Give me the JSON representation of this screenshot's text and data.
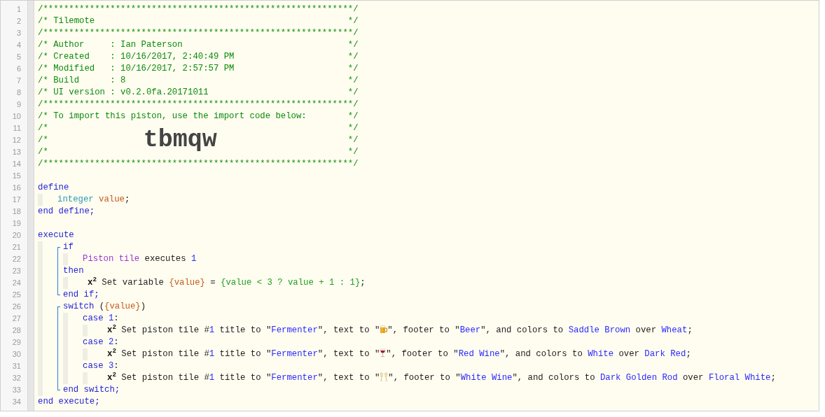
{
  "lines": [
    {
      "kind": "line",
      "n": "1",
      "tokens": [
        {
          "kind": "comment",
          "text": "/************************************************************/"
        }
      ]
    },
    {
      "kind": "line",
      "n": "2",
      "tokens": [
        {
          "kind": "comment",
          "text": "/* Tilemote                                                 */"
        }
      ]
    },
    {
      "kind": "line",
      "n": "3",
      "tokens": [
        {
          "kind": "comment",
          "text": "/************************************************************/"
        }
      ]
    },
    {
      "kind": "line",
      "n": "4",
      "tokens": [
        {
          "kind": "comment",
          "text": "/* Author     : Ian Paterson                                */"
        }
      ]
    },
    {
      "kind": "line",
      "n": "5",
      "tokens": [
        {
          "kind": "comment",
          "text": "/* Created    : 10/16/2017, 2:40:49 PM                      */"
        }
      ]
    },
    {
      "kind": "line",
      "n": "6",
      "tokens": [
        {
          "kind": "comment",
          "text": "/* Modified   : 10/16/2017, 2:57:57 PM                      */"
        }
      ]
    },
    {
      "kind": "line",
      "n": "7",
      "tokens": [
        {
          "kind": "comment",
          "text": "/* Build      : 8                                           */"
        }
      ]
    },
    {
      "kind": "line",
      "n": "8",
      "tokens": [
        {
          "kind": "comment",
          "text": "/* UI version : v0.2.0fa.20171011                           */"
        }
      ]
    },
    {
      "kind": "line",
      "n": "9",
      "tokens": [
        {
          "kind": "comment",
          "text": "/************************************************************/"
        }
      ]
    },
    {
      "kind": "line",
      "n": "10",
      "tokens": [
        {
          "kind": "comment",
          "text": "/* To import this piston, use the import code below:        */"
        }
      ]
    },
    {
      "kind": "line",
      "n": "11",
      "tokens": [
        {
          "kind": "comment",
          "text": "/*"
        },
        {
          "kind": "comment_end",
          "text": "*/"
        }
      ]
    },
    {
      "kind": "line",
      "n": "12",
      "tokens": [
        {
          "kind": "comment",
          "text": "/*"
        },
        {
          "kind": "import",
          "text": "tbmqw"
        },
        {
          "kind": "comment_end",
          "text": "*/"
        }
      ]
    },
    {
      "kind": "line",
      "n": "13",
      "tokens": [
        {
          "kind": "comment",
          "text": "/*"
        },
        {
          "kind": "comment_end",
          "text": "*/"
        }
      ]
    },
    {
      "kind": "line",
      "n": "14",
      "tokens": [
        {
          "kind": "comment",
          "text": "/************************************************************/"
        }
      ]
    },
    {
      "kind": "line",
      "n": "15"
    },
    {
      "kind": "line",
      "n": "16",
      "tokens": [
        {
          "kind": "keyword",
          "text": "define"
        }
      ],
      "children": [
        {
          "kind": "line",
          "n": "17",
          "tokens": [
            {
              "kind": "type",
              "text": "integer "
            },
            {
              "kind": "variable",
              "text": "value"
            },
            {
              "kind": "plain",
              "text": ";"
            }
          ]
        }
      ]
    },
    {
      "kind": "line",
      "n": "18",
      "tokens": [
        {
          "kind": "keyword",
          "text": "end define;"
        }
      ]
    },
    {
      "kind": "line",
      "n": "19"
    },
    {
      "kind": "line",
      "n": "20",
      "tokens": [
        {
          "kind": "keyword",
          "text": "execute"
        }
      ],
      "children": [
        {
          "kind": "block",
          "lines": [
            {
              "kind": "line",
              "n": "21",
              "tokens": [
                {
                  "kind": "keyword",
                  "text": "if"
                }
              ],
              "children": [
                {
                  "kind": "line",
                  "n": "22",
                  "tokens": [
                    {
                      "kind": "device",
                      "text": "Piston tile"
                    },
                    {
                      "kind": "plain",
                      "text": " executes "
                    },
                    {
                      "kind": "literal",
                      "text": "1"
                    }
                  ]
                }
              ]
            },
            {
              "kind": "line",
              "n": "23",
              "tokens": [
                {
                  "kind": "keyword",
                  "text": "then"
                }
              ],
              "children": [
                {
                  "kind": "line",
                  "n": "24",
                  "tokens": [
                    {
                      "kind": "task",
                      "text": "x$^{2}$"
                    },
                    {
                      "kind": "plain",
                      "text": " Set variable "
                    },
                    {
                      "kind": "variable",
                      "text": "{value}"
                    },
                    {
                      "kind": "plain",
                      "text": " = "
                    },
                    {
                      "kind": "expression",
                      "text": "{value < 3 ? value + 1 : 1}"
                    },
                    {
                      "kind": "plain",
                      "text": ";"
                    }
                  ]
                }
              ]
            },
            {
              "kind": "line",
              "n": "25",
              "tokens": [
                {
                  "kind": "keyword",
                  "text": "end if;"
                }
              ]
            }
          ]
        },
        {
          "kind": "block",
          "lines": [
            {
              "kind": "line",
              "n": "26",
              "tokens": [
                {
                  "kind": "keyword",
                  "text": "switch"
                },
                {
                  "kind": "plain",
                  "text": " ("
                },
                {
                  "kind": "variable",
                  "text": "{value}"
                },
                {
                  "kind": "plain",
                  "text": ")"
                }
              ],
              "children": [
                {
                  "kind": "line",
                  "n": "27",
                  "tokens": [
                    {
                      "kind": "keyword",
                      "text": "case "
                    },
                    {
                      "kind": "literal",
                      "text": "1"
                    },
                    {
                      "kind": "plain",
                      "text": ":"
                    }
                  ],
                  "children": [
                    {
                      "kind": "line",
                      "n": "28",
                      "tokens": [
                        {
                          "kind": "task",
                          "text": "x$^{2}$"
                        },
                        {
                          "kind": "plain",
                          "text": " Set piston tile #"
                        },
                        {
                          "kind": "literal",
                          "text": "1"
                        },
                        {
                          "kind": "plain",
                          "text": " title to \""
                        },
                        {
                          "kind": "literal",
                          "text": "Fermenter"
                        },
                        {
                          "kind": "plain",
                          "text": "\", text to \""
                        },
                        {
                          "kind": "icon"
                        },
                        {
                          "kind": "plain",
                          "text": "\", footer to \""
                        },
                        {
                          "kind": "literal",
                          "text": "Beer"
                        },
                        {
                          "kind": "plain",
                          "text": "\", and colors to "
                        },
                        {
                          "kind": "literal",
                          "text": "Saddle Brown"
                        },
                        {
                          "kind": "plain",
                          "text": " over "
                        },
                        {
                          "kind": "literal",
                          "text": "Wheat"
                        },
                        {
                          "kind": "plain",
                          "text": ";"
                        }
                      ]
                    }
                  ]
                },
                {
                  "kind": "line",
                  "n": "29",
                  "tokens": [
                    {
                      "kind": "keyword",
                      "text": "case "
                    },
                    {
                      "kind": "literal",
                      "text": "2"
                    },
                    {
                      "kind": "plain",
                      "text": ":"
                    }
                  ],
                  "children": [
                    {
                      "kind": "line",
                      "n": "30",
                      "tokens": [
                        {
                          "kind": "task",
                          "text": "x$^{2}$"
                        },
                        {
                          "kind": "plain",
                          "text": " Set piston tile #"
                        },
                        {
                          "kind": "literal",
                          "text": "1"
                        },
                        {
                          "kind": "plain",
                          "text": " title to \""
                        },
                        {
                          "kind": "literal",
                          "text": "Fermenter"
                        },
                        {
                          "kind": "plain",
                          "text": "\", text to \""
                        },
                        {
                          "kind": "icon"
                        },
                        {
                          "kind": "plain",
                          "text": "\", footer to \""
                        },
                        {
                          "kind": "literal",
                          "text": "Red Wine"
                        },
                        {
                          "kind": "plain",
                          "text": "\", and colors to "
                        },
                        {
                          "kind": "literal",
                          "text": "White"
                        },
                        {
                          "kind": "plain",
                          "text": " over "
                        },
                        {
                          "kind": "literal",
                          "text": "Dark Red"
                        },
                        {
                          "kind": "plain",
                          "text": ";"
                        }
                      ]
                    }
                  ]
                },
                {
                  "kind": "line",
                  "n": "31",
                  "tokens": [
                    {
                      "kind": "keyword",
                      "text": "case "
                    },
                    {
                      "kind": "literal",
                      "text": "3"
                    },
                    {
                      "kind": "plain",
                      "text": ":"
                    }
                  ],
                  "children": [
                    {
                      "kind": "line",
                      "n": "32",
                      "tokens": [
                        {
                          "kind": "task",
                          "text": "x$^{2}$"
                        },
                        {
                          "kind": "plain",
                          "text": " Set piston tile #"
                        },
                        {
                          "kind": "literal",
                          "text": "1"
                        },
                        {
                          "kind": "plain",
                          "text": " title to \""
                        },
                        {
                          "kind": "literal",
                          "text": "Fermenter"
                        },
                        {
                          "kind": "plain",
                          "text": "\", text to \""
                        },
                        {
                          "kind": "icon"
                        },
                        {
                          "kind": "plain",
                          "text": "\", footer to \""
                        },
                        {
                          "kind": "literal",
                          "text": "White Wine"
                        },
                        {
                          "kind": "plain",
                          "text": "\", and colors to "
                        },
                        {
                          "kind": "literal",
                          "text": "Dark Golden Rod"
                        },
                        {
                          "kind": "plain",
                          "text": " over "
                        },
                        {
                          "kind": "literal",
                          "text": "Floral White"
                        },
                        {
                          "kind": "plain",
                          "text": ";"
                        }
                      ]
                    }
                  ]
                }
              ]
            },
            {
              "kind": "line",
              "n": "33",
              "tokens": [
                {
                  "kind": "keyword",
                  "text": "end switch;"
                }
              ]
            }
          ]
        }
      ]
    },
    {
      "kind": "line",
      "n": "34",
      "tokens": [
        {
          "kind": "keyword",
          "text": "end execute;"
        }
      ]
    }
  ]
}
